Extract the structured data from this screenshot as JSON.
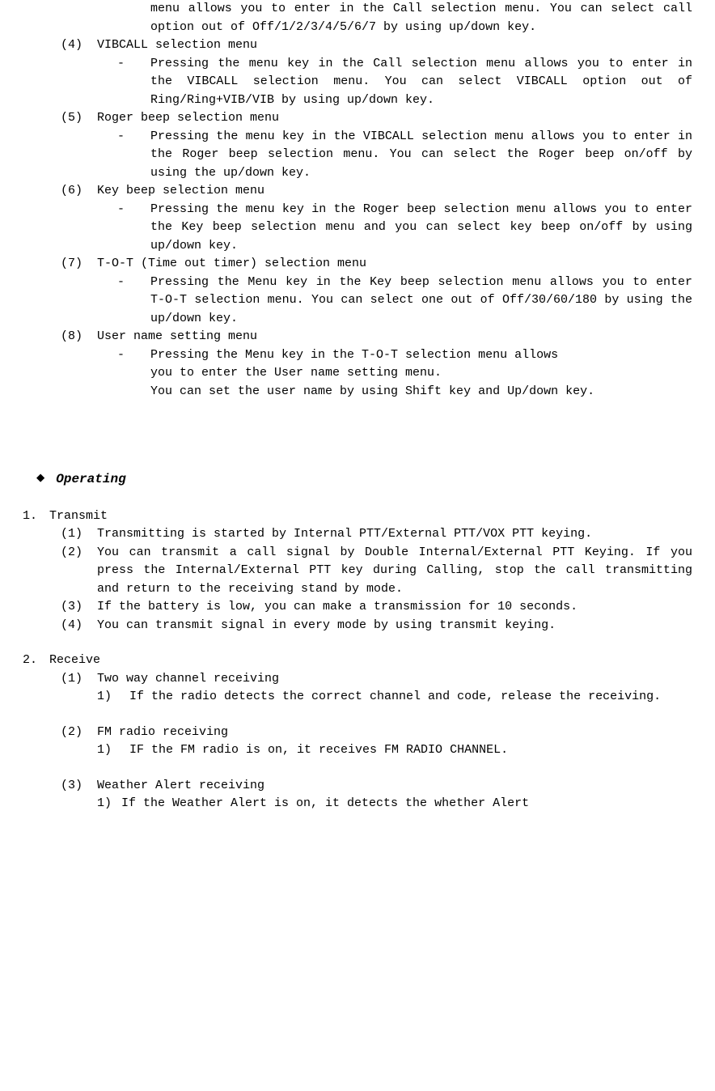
{
  "top": {
    "cont1": "menu allows you to enter in the Call selection menu. You can select call option out of Off/1/2/3/4/5/6/7 by using up/down key."
  },
  "m4": {
    "num": "(4)",
    "title": "VIBCALL selection menu",
    "dash": "Pressing the menu key in the Call selection menu allows you to enter in the VIBCALL selection menu. You can select VIBCALL option out of Ring/Ring+VIB/VIB by using up/down key."
  },
  "m5": {
    "num": "(5)",
    "title": "Roger beep selection menu",
    "dash": "Pressing the menu key in the VIBCALL selection menu allows you to enter in the Roger beep selection menu. You can select the Roger beep on/off by using the up/down key."
  },
  "m6": {
    "num": "(6)",
    "title": "Key beep selection menu",
    "dash": "Pressing the menu key in the Roger beep selection menu allows you to enter the Key beep selection menu and you can select key beep on/off by using up/down key."
  },
  "m7": {
    "num": "(7)",
    "title": "T-O-T (Time out timer) selection menu",
    "dash": "Pressing the Menu key in the Key beep selection menu allows you to enter T-O-T selection menu. You can select one out of Off/30/60/180 by using the up/down key."
  },
  "m8": {
    "num": "(8)",
    "title": "User name setting menu",
    "dash": "Pressing the Menu key in the T-O-T selection menu allows",
    "cont1": " you to enter the User name setting menu.",
    "cont2": "You can set the user name by using Shift key and Up/down key."
  },
  "operating": {
    "title": "Operating"
  },
  "s1": {
    "num": "1.",
    "title": "Transmit",
    "i1": {
      "num": "(1)",
      "text": "Transmitting is started by Internal PTT/External PTT/VOX PTT keying."
    },
    "i2": {
      "num": "(2)",
      "text": "You can transmit a call signal by Double Internal/External PTT Keying. If you press the Internal/External PTT key during Calling, stop the call transmitting and return to the receiving stand by mode."
    },
    "i3": {
      "num": "(3)",
      "text": "If the battery is low, you can make a transmission for 10 seconds."
    },
    "i4": {
      "num": "(4)",
      "text": "You can transmit signal in every mode by using transmit keying."
    }
  },
  "s2": {
    "num": "2.",
    "title": "Receive",
    "i1": {
      "num": "(1)",
      "title": "Two way channel receiving",
      "sub1num": "1)",
      "sub1text": "If the radio detects the correct channel and code, release the receiving."
    },
    "i2": {
      "num": "(2)",
      "title": "FM radio receiving",
      "sub1num": "1)",
      "sub1text": "IF the FM radio is on, it receives FM RADIO CHANNEL."
    },
    "i3": {
      "num": "(3)",
      "title": "Weather Alert receiving",
      "sub1num": "1)",
      "sub1text": "If the Weather Alert is on, it detects the whether Alert"
    }
  }
}
